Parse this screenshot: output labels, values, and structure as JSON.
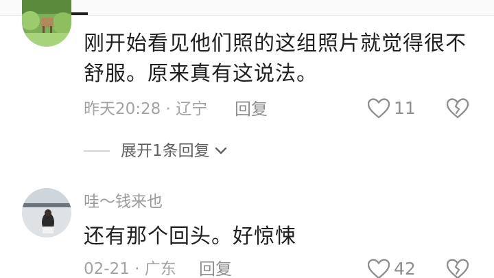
{
  "comments": [
    {
      "text": "刚开始看见他们照的这组照片就觉得很不舒服。原来真有这说法。",
      "time": "昨天20:28",
      "location": "辽宁",
      "reply_label": "回复",
      "likes": "11",
      "expand_label": "展开1条回复"
    },
    {
      "username": "哇～钱来也",
      "text": "还有那个回头。好惊悚",
      "time": "02-21",
      "location": "广东",
      "reply_label": "回复",
      "likes": "42"
    }
  ],
  "separator": " · ",
  "colors": {
    "text": "#1f1f1f",
    "meta": "#a3a3a3",
    "icon": "#8e8e8e"
  },
  "icons": [
    "heart-outline-icon",
    "broken-heart-icon",
    "chevron-down-icon"
  ]
}
